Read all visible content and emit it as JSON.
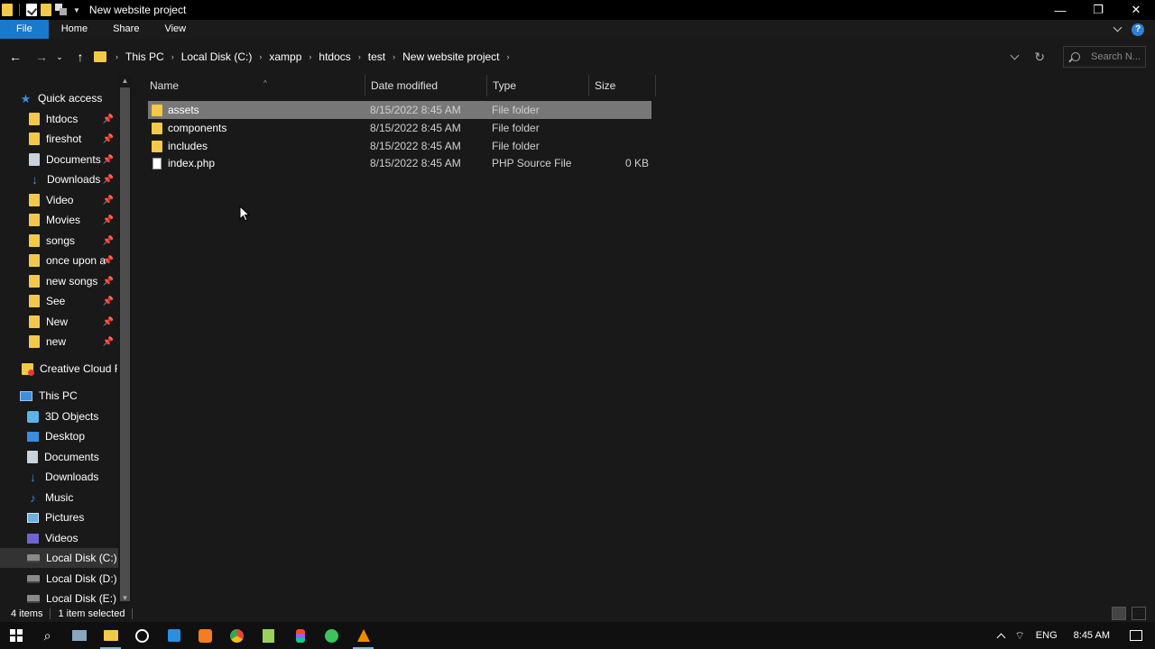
{
  "window": {
    "title": "New website project",
    "controls": {
      "minimize": "—",
      "restore": "❐",
      "close": "✕"
    }
  },
  "ribbon": {
    "tabs": [
      "File",
      "Home",
      "Share",
      "View"
    ]
  },
  "address": {
    "breadcrumbs": [
      "This PC",
      "Local Disk (C:)",
      "xampp",
      "htdocs",
      "test",
      "New website project"
    ],
    "search_placeholder": "Search N..."
  },
  "nav": {
    "quick_access_label": "Quick access",
    "quick_access": [
      "htdocs",
      "fireshot",
      "Documents",
      "Downloads",
      "Video",
      "Movies",
      "songs",
      "once upon a t",
      "new songs",
      "See",
      "New",
      "new"
    ],
    "creative_cloud": "Creative Cloud Fil",
    "this_pc_label": "This PC",
    "this_pc": [
      "3D Objects",
      "Desktop",
      "Documents",
      "Downloads",
      "Music",
      "Pictures",
      "Videos",
      "Local Disk (C:)",
      "Local Disk  (D:)",
      "Local Disk (E:)"
    ]
  },
  "files": {
    "columns": [
      "Name",
      "Date modified",
      "Type",
      "Size"
    ],
    "rows": [
      {
        "name": "assets",
        "date": "8/15/2022 8:45 AM",
        "type": "File folder",
        "size": "",
        "icon": "folder-icon",
        "selected": true
      },
      {
        "name": "components",
        "date": "8/15/2022 8:45 AM",
        "type": "File folder",
        "size": "",
        "icon": "folder-icon",
        "selected": false
      },
      {
        "name": "includes",
        "date": "8/15/2022 8:45 AM",
        "type": "File folder",
        "size": "",
        "icon": "folder-icon",
        "selected": false
      },
      {
        "name": "index.php",
        "date": "8/15/2022 8:45 AM",
        "type": "PHP Source File",
        "size": "0 KB",
        "icon": "php-file-icon",
        "selected": false
      }
    ]
  },
  "status": {
    "item_count": "4 items",
    "selected": "1 item selected"
  },
  "taskbar": {
    "language": "ENG",
    "time": "8:45 AM"
  },
  "colors": {
    "accent": "#1979ca",
    "folder": "#f3c94b",
    "selection": "#777777",
    "background": "#191919"
  }
}
